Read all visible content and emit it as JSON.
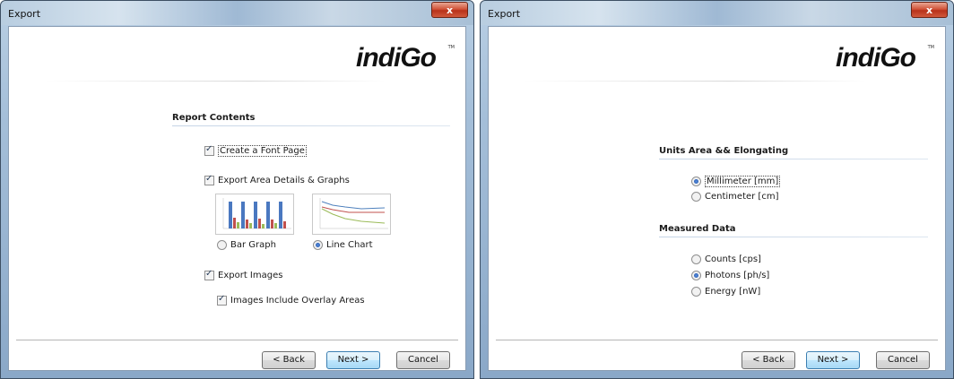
{
  "dialogs": [
    {
      "title": "Export",
      "close_label": "x",
      "logo": {
        "text": "indiGo",
        "tm": "TM"
      },
      "section_title": "Report Contents",
      "options": {
        "font_page": "Create a Font Page",
        "area_details": "Export Area Details & Graphs",
        "bar_graph": "Bar Graph",
        "line_chart": "Line Chart",
        "export_images": "Export Images",
        "overlay_areas": "Images Include Overlay Areas"
      },
      "state": {
        "font_page_checked": true,
        "area_details_checked": true,
        "graph_type_selected": "Line Chart",
        "export_images_checked": true,
        "overlay_areas_checked": true
      },
      "buttons": {
        "back": "< Back",
        "next": "Next >",
        "cancel": "Cancel"
      }
    },
    {
      "title": "Export",
      "close_label": "x",
      "logo": {
        "text": "indiGo",
        "tm": "TM"
      },
      "units_title": "Units Area && Elongating",
      "units_options": [
        "Millimeter [mm]",
        "Centimeter [cm]"
      ],
      "units_selected": "Millimeter [mm]",
      "measured_title": "Measured Data",
      "measured_options": [
        "Counts [cps]",
        "Photons [ph/s]",
        "Energy [nW]"
      ],
      "measured_selected": "Photons [ph/s]",
      "buttons": {
        "back": "< Back",
        "next": "Next >",
        "cancel": "Cancel"
      }
    }
  ],
  "colors": {
    "close_button": "#c8412a",
    "default_button_border": "#3c7fb1",
    "bar_colors": [
      "#4a78c0",
      "#c0504d",
      "#9bbb59"
    ],
    "line_colors": [
      "#4f81bd",
      "#c0504d",
      "#9bbb59"
    ]
  }
}
